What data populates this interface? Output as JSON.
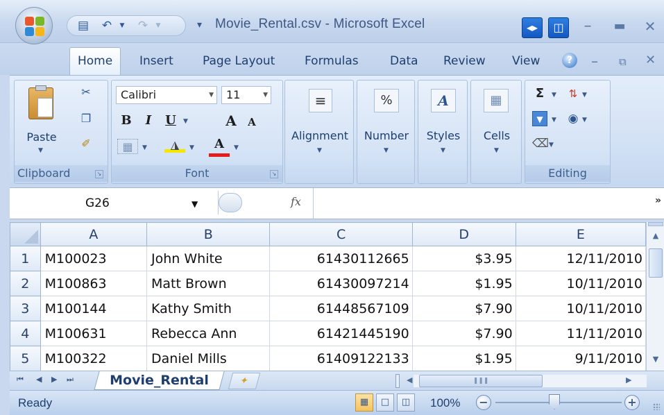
{
  "window": {
    "title": "Movie_Rental.csv - Microsoft Excel"
  },
  "ribbon_tabs": [
    {
      "label": "Home"
    },
    {
      "label": "Insert"
    },
    {
      "label": "Page Layout"
    },
    {
      "label": "Formulas"
    },
    {
      "label": "Data"
    },
    {
      "label": "Review"
    },
    {
      "label": "View"
    }
  ],
  "ribbon": {
    "clipboard": {
      "paste_label": "Paste",
      "group_label": "Clipboard"
    },
    "font": {
      "font_name": "Calibri",
      "font_size": "11",
      "bold": "B",
      "italic": "I",
      "underline": "U",
      "grow": "A",
      "shrink": "A",
      "font_color": "A",
      "group_label": "Font"
    },
    "alignment": {
      "label": "Alignment"
    },
    "number": {
      "label": "Number",
      "icon_text": "%"
    },
    "styles": {
      "label": "Styles"
    },
    "cells": {
      "label": "Cells"
    },
    "editing": {
      "group_label": "Editing",
      "sum": "Σ"
    }
  },
  "formula_bar": {
    "name_box": "G26",
    "fx": "fx",
    "formula": ""
  },
  "columns": [
    "A",
    "B",
    "C",
    "D",
    "E"
  ],
  "rows": [
    {
      "num": "1",
      "A": "M100023",
      "B": "John White",
      "C": "61430112665",
      "D": "$3.95",
      "E": "12/11/2010"
    },
    {
      "num": "2",
      "A": "M100863",
      "B": "Matt Brown",
      "C": "61430097214",
      "D": "$1.95",
      "E": "10/11/2010"
    },
    {
      "num": "3",
      "A": "M100144",
      "B": "Kathy Smith",
      "C": "61448567109",
      "D": "$7.90",
      "E": "10/11/2010"
    },
    {
      "num": "4",
      "A": "M100631",
      "B": "Rebecca Ann",
      "C": "61421445190",
      "D": "$7.90",
      "E": "11/11/2010"
    },
    {
      "num": "5",
      "A": "M100322",
      "B": "Daniel Mills",
      "C": "61409122133",
      "D": "$1.95",
      "E": "9/11/2010"
    }
  ],
  "sheet_tabs": [
    {
      "label": "Movie_Rental"
    }
  ],
  "status_bar": {
    "status": "Ready",
    "zoom": "100%"
  },
  "colors": {
    "accent": "#1e3f6e",
    "ribbon_bg": "#d2e1f4",
    "active_view": "#f6c35d"
  }
}
